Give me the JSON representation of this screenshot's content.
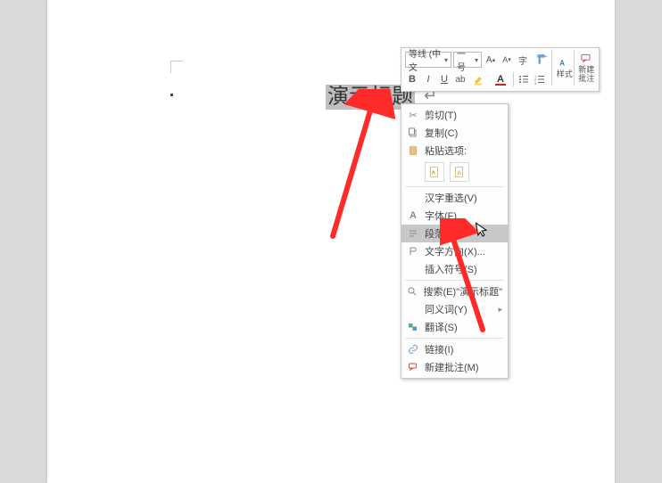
{
  "heading_text": "演示标题",
  "mini_toolbar": {
    "font_name": "等线 (中文",
    "font_size": "一号",
    "styles_label": "样式",
    "new_comment_label": "新建\n批注"
  },
  "context_menu": {
    "cut": "剪切(T)",
    "copy": "复制(C)",
    "paste_label": "粘贴选项:",
    "cn_reselect": "汉字重选(V)",
    "font": "字体(F)...",
    "paragraph": "段落(P)...",
    "text_dir": "文字方向(X)...",
    "insert_symbol": "插入符号(S)",
    "search": "搜索(E)\"演示标题\"",
    "synonym": "同义词(Y)",
    "translate": "翻译(S)",
    "link": "链接(I)",
    "new_comment": "新建批注(M)"
  },
  "arrows": {
    "color": "#ff2a2a"
  }
}
